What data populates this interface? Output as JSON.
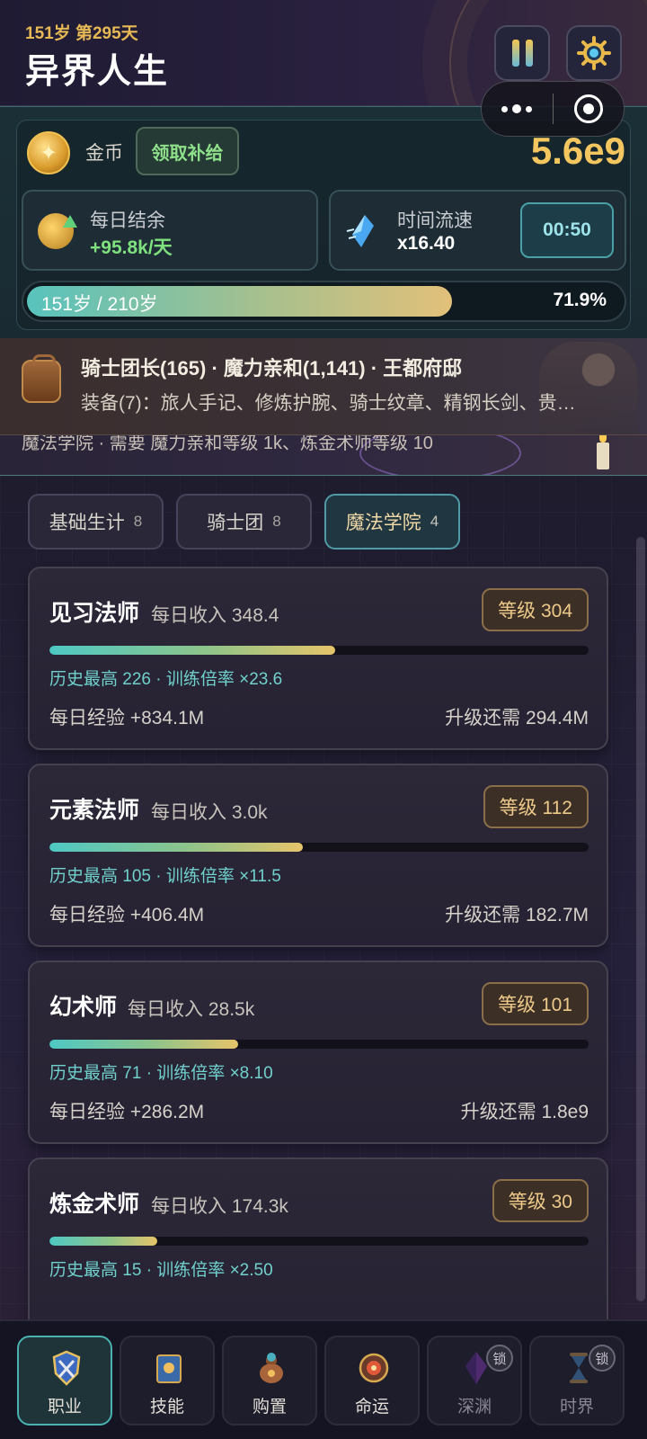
{
  "header": {
    "age_line": "151岁 第295天",
    "title": "异界人生"
  },
  "resources": {
    "gold_label": "金币",
    "claim_button": "领取补给",
    "gold_value": "5.6e9",
    "daily_label": "每日结余",
    "daily_value": "+95.8k/天",
    "speed_label": "时间流速",
    "speed_value": "x16.40",
    "timer": "00:50",
    "life_text": "151岁 / 210岁",
    "life_percent": "71.9%",
    "life_fraction": 0.719
  },
  "status": {
    "line1": "骑士团长(165) · 魔力亲和(1,141) · 王都府邸",
    "line2": "装备(7)：旅人手记、修炼护腕、骑士纹章、精钢长剑、贵…"
  },
  "hint": {
    "text": "魔法学院 · 需要 魔力亲和等级 1k、炼金术师等级 10"
  },
  "tabs": [
    {
      "label": "基础生计",
      "count": "8",
      "active": false
    },
    {
      "label": "骑士团",
      "count": "8",
      "active": false
    },
    {
      "label": "魔法学院",
      "count": "4",
      "active": true
    }
  ],
  "jobs": [
    {
      "name": "见习法师",
      "income": "每日收入 348.4",
      "level": "等级 304",
      "progress": 0.53,
      "history": "历史最高 226 · 训练倍率 ×23.6",
      "exp": "每日经验 +834.1M",
      "need": "升级还需 294.4M"
    },
    {
      "name": "元素法师",
      "income": "每日收入 3.0k",
      "level": "等级 112",
      "progress": 0.47,
      "history": "历史最高 105 · 训练倍率 ×11.5",
      "exp": "每日经验 +406.4M",
      "need": "升级还需 182.7M"
    },
    {
      "name": "幻术师",
      "income": "每日收入 28.5k",
      "level": "等级 101",
      "progress": 0.35,
      "history": "历史最高 71 · 训练倍率 ×8.10",
      "exp": "每日经验 +286.2M",
      "need": "升级还需 1.8e9"
    },
    {
      "name": "炼金术师",
      "income": "每日收入 174.3k",
      "level": "等级 30",
      "progress": 0.2,
      "history": "历史最高 15 · 训练倍率 ×2.50",
      "exp": "",
      "need": ""
    }
  ],
  "nav": [
    {
      "label": "职业",
      "icon": "shield-icon",
      "active": true,
      "locked": false
    },
    {
      "label": "技能",
      "icon": "book-icon",
      "active": false,
      "locked": false
    },
    {
      "label": "购置",
      "icon": "bag-icon",
      "active": false,
      "locked": false
    },
    {
      "label": "命运",
      "icon": "compass-icon",
      "active": false,
      "locked": false
    },
    {
      "label": "深渊",
      "icon": "crystal-icon",
      "active": false,
      "locked": true
    },
    {
      "label": "时界",
      "icon": "hourglass-icon",
      "active": false,
      "locked": true
    }
  ],
  "lock_label": "锁"
}
